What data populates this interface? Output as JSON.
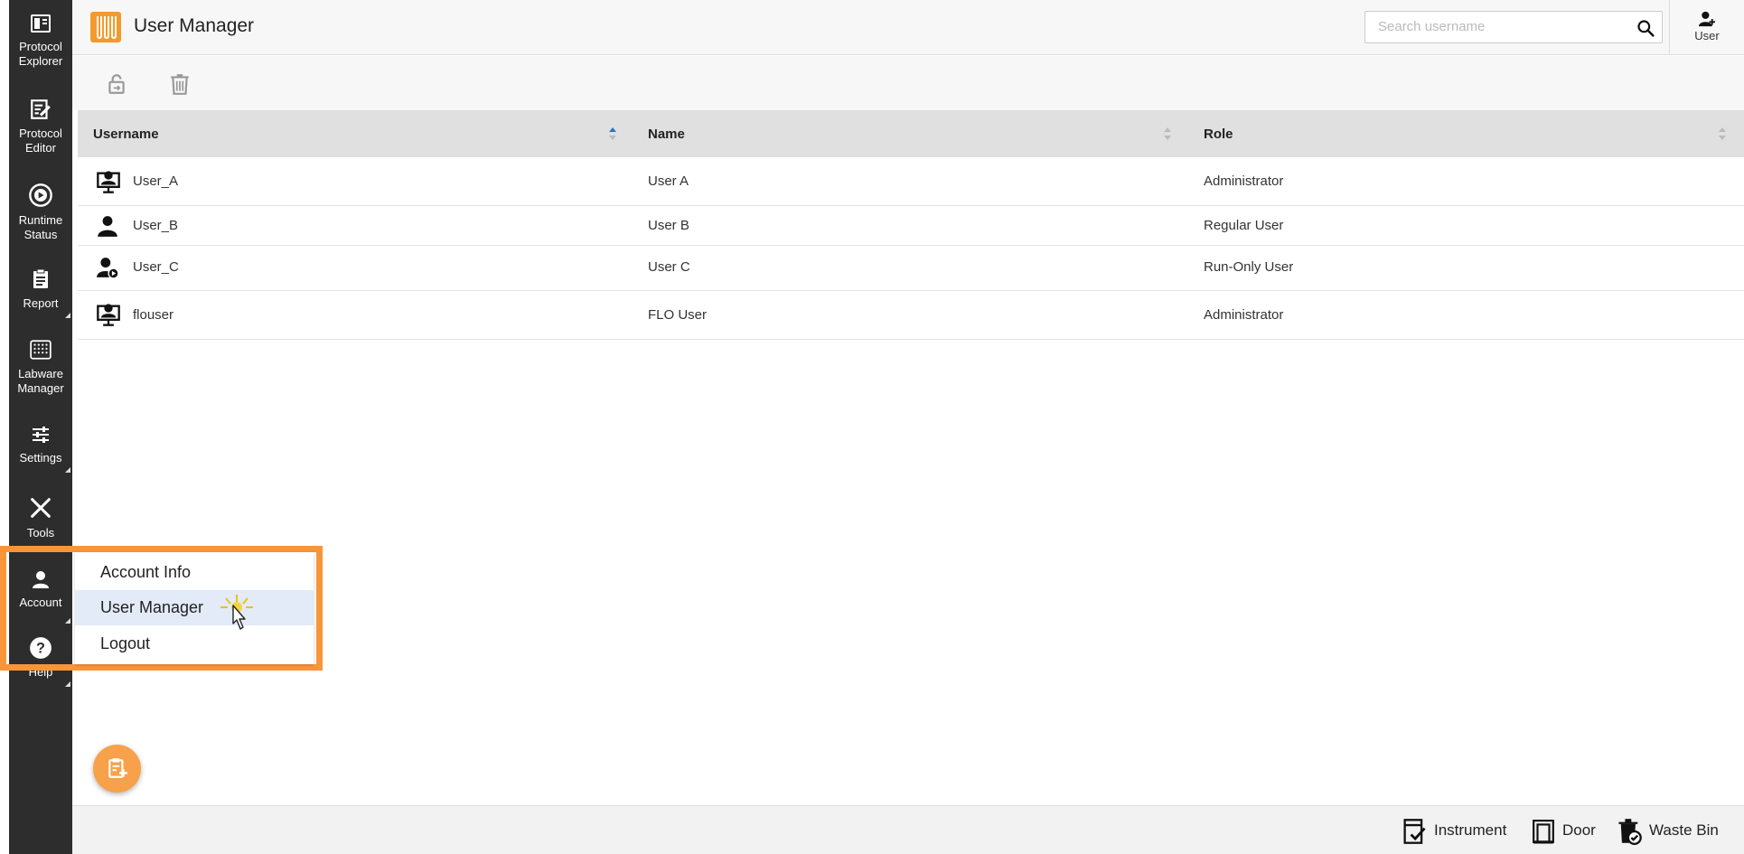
{
  "sidebar": {
    "items": [
      {
        "label1": "Protocol",
        "label2": "Explorer",
        "icon": "protocol-explorer-icon"
      },
      {
        "label1": "Protocol",
        "label2": "Editor",
        "icon": "protocol-editor-icon"
      },
      {
        "label1": "Runtime",
        "label2": "Status",
        "icon": "runtime-status-icon"
      },
      {
        "label1": "Report",
        "label2": "",
        "icon": "report-icon"
      },
      {
        "label1": "Labware",
        "label2": "Manager",
        "icon": "labware-icon"
      },
      {
        "label1": "Settings",
        "label2": "",
        "icon": "settings-icon"
      },
      {
        "label1": "Tools",
        "label2": "",
        "icon": "tools-icon"
      },
      {
        "label1": "Account",
        "label2": "",
        "icon": "account-icon"
      },
      {
        "label1": "Help",
        "label2": "",
        "icon": "help-icon"
      }
    ]
  },
  "header": {
    "title": "User Manager",
    "search_placeholder": "Search username",
    "user_label": "User"
  },
  "table": {
    "columns": [
      "Username",
      "Name",
      "Role"
    ],
    "rows": [
      {
        "username": "User_A",
        "name": "User A",
        "role": "Administrator",
        "icon": "admin-user-icon"
      },
      {
        "username": "User_B",
        "name": "User B",
        "role": "Regular User",
        "icon": "regular-user-icon"
      },
      {
        "username": "User_C",
        "name": "User C",
        "role": "Run-Only User",
        "icon": "run-only-user-icon"
      },
      {
        "username": "flouser",
        "name": "FLO User",
        "role": "Administrator",
        "icon": "admin-user-icon"
      }
    ]
  },
  "account_menu": {
    "items": [
      "Account Info",
      "User Manager",
      "Logout"
    ],
    "highlighted": "User Manager"
  },
  "status": {
    "instrument": "Instrument",
    "door": "Door",
    "waste_bin": "Waste Bin"
  },
  "colors": {
    "sidebar_bg": "#2d2d2d",
    "accent": "#f7953b",
    "header_bg": "#e0e0e0",
    "highlight": "#e2ebf7"
  }
}
